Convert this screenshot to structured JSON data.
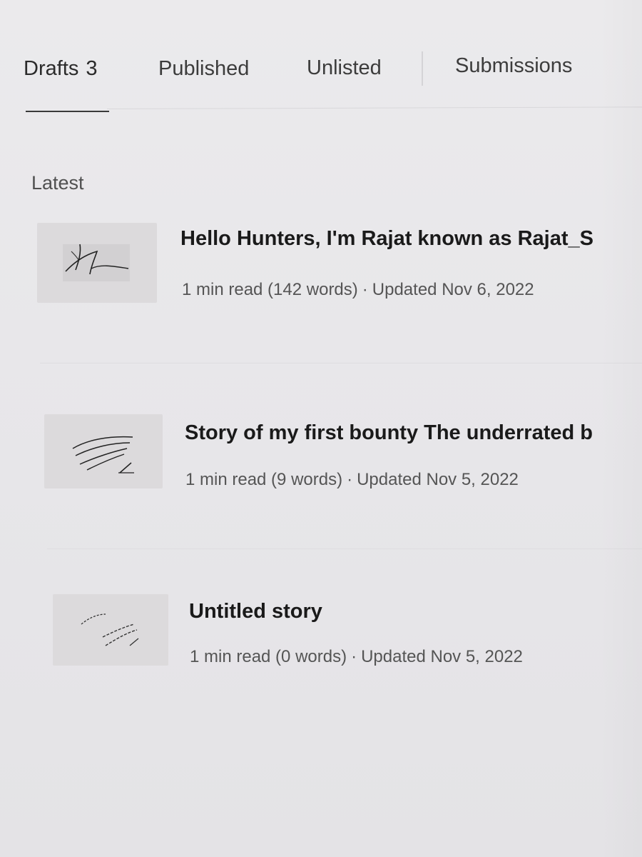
{
  "tabs": [
    {
      "label": "Drafts",
      "count": "3"
    },
    {
      "label": "Published"
    },
    {
      "label": "Unlisted"
    },
    {
      "label": "Submissions"
    }
  ],
  "section_label": "Latest",
  "stories": [
    {
      "title": "Hello Hunters, I'm Rajat known as Rajat_S",
      "read_time": "1 min read (142 words)",
      "separator": "·",
      "updated": "Updated Nov 6, 2022"
    },
    {
      "title": "Story of my first bounty The underrated b",
      "read_time": "1 min read (9 words)",
      "separator": "·",
      "updated": "Updated Nov 5, 2022"
    },
    {
      "title": "Untitled story",
      "read_time": "1 min read (0 words)",
      "separator": "·",
      "updated": "Updated Nov 5, 2022"
    }
  ],
  "colors": {
    "background": "#e8e7ea",
    "title": "#1a1a1a",
    "meta": "#555555",
    "active_underline": "#3a3a3a"
  }
}
